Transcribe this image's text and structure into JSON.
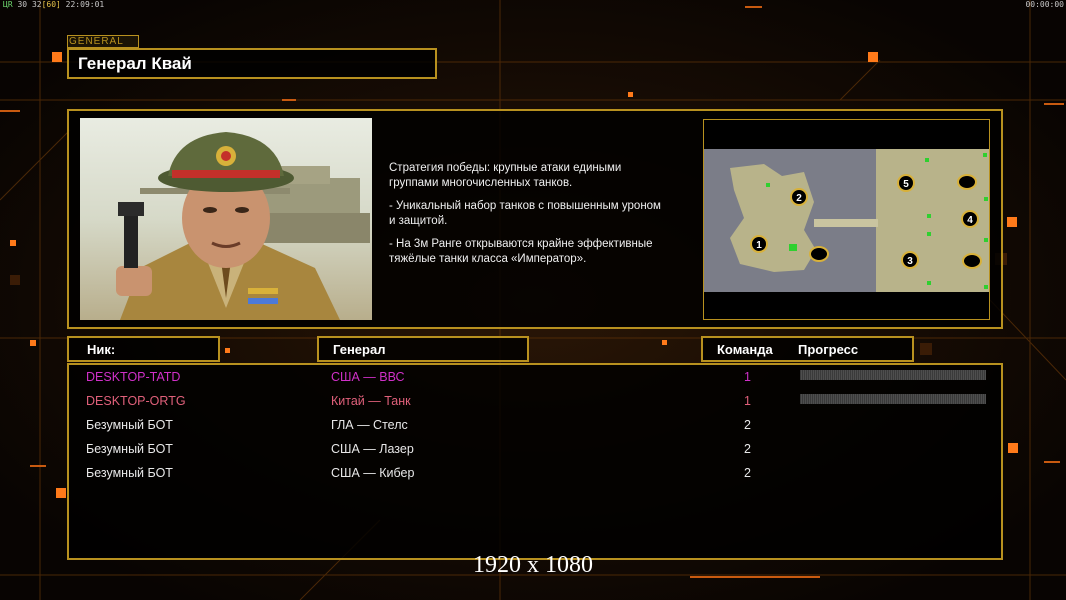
{
  "hud": {
    "left_a": "ЦR",
    "left_b": "30",
    "left_c": "32",
    "left_d": "[60]",
    "left_time": "22:09:01",
    "right_time": "00:00:00"
  },
  "general": {
    "tag": "GENERAL",
    "name": "Генерал Квай"
  },
  "description": {
    "p1": "Стратегия победы: крупные атаки едиными\n группами многочисленных танков.",
    "p2": "- Уникальный набор танков с повышенным уроном\n и защитой.",
    "p3": "- На 3м Ранге открываются крайне эффективные\n тяжёлые танки класса «Император»."
  },
  "minimap": {
    "slots": [
      "1",
      "2",
      "3",
      "4",
      "5"
    ]
  },
  "table": {
    "col_nick": "Ник:",
    "col_general": "Генерал",
    "col_team": "Команда",
    "col_progress": "Прогресс",
    "rows": [
      {
        "nick": "DESKTOP-TATD",
        "general": "США — ВВС",
        "team": "1",
        "color": "#d030c8",
        "progress": true
      },
      {
        "nick": "DESKTOP-ORTG",
        "general": "Китай — Танк",
        "team": "1",
        "color": "#e0607a",
        "progress": true
      },
      {
        "nick": "Безумный БОТ",
        "general": "ГЛА — Стелс",
        "team": "2",
        "color": "#e8e8e8",
        "progress": false
      },
      {
        "nick": "Безумный БОТ",
        "general": "США — Лазер",
        "team": "2",
        "color": "#e8e8e8",
        "progress": false
      },
      {
        "nick": "Безумный БОТ",
        "general": "США — Кибер",
        "team": "2",
        "color": "#e8e8e8",
        "progress": false
      }
    ]
  },
  "resolution": "1920 x 1080",
  "colors": {
    "frame": "#b8911f",
    "accent_orange": "#ff7a1a"
  }
}
